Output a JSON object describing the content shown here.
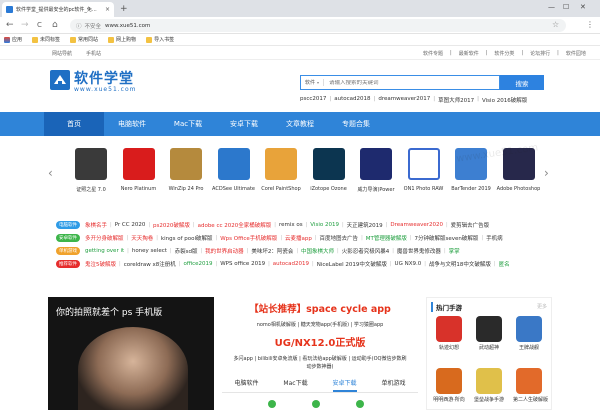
{
  "browser": {
    "tab_title": "软件学堂_提供最安全的pc软件_免...",
    "tab_close": "×",
    "new_tab": "+",
    "window_controls": [
      "—",
      "☐",
      "✕"
    ],
    "nav": {
      "back": "←",
      "forward": "→",
      "reload": "C",
      "home": "⌂"
    },
    "address": {
      "security": "不安全",
      "url": "www.xue51.com"
    },
    "bookmarks": [
      "应用",
      "未同标签",
      "常用同站",
      "网上购物",
      "导入书签"
    ]
  },
  "toplinks": {
    "left": [
      "网站导航",
      "手机站"
    ],
    "right": [
      "软件专题",
      "|",
      "最新软件",
      "|",
      "软件分类",
      "|",
      "论坛排行",
      "|",
      "软件园地"
    ]
  },
  "logo": {
    "cn": "软件学堂",
    "url": "www.xue51.com"
  },
  "search": {
    "category": "软件",
    "category_arrow": "▾",
    "placeholder": "请输入搜索的关键词",
    "button": "搜索",
    "hot": [
      "pscc2017",
      "|",
      "autocad2018",
      "|",
      "dreamweaver2017",
      "|",
      "草图大师2017",
      "|",
      "Visio 2016破解版"
    ]
  },
  "mainnav": [
    "首页",
    "电脑软件",
    "Mac下载",
    "安卓下载",
    "文章教程",
    "专题合集"
  ],
  "carousel": {
    "prev": "‹",
    "next": "›",
    "items": [
      {
        "label": "证照之星 7.0",
        "color": "#3a3a3a"
      },
      {
        "label": "Nero Platinum",
        "color": "#d91c1c"
      },
      {
        "label": "WinZip 24 Pro",
        "color": "#b58a3d"
      },
      {
        "label": "ACDSee Ultimate",
        "color": "#2c78cc"
      },
      {
        "label": "Corel PaintShop",
        "color": "#e8a33a"
      },
      {
        "label": "iZotope Ozone",
        "color": "#0c3550"
      },
      {
        "label": "威力导演(Power",
        "color": "#1e2a6e"
      },
      {
        "label": "ON1 Photo RAW",
        "color": "#ffffff"
      },
      {
        "label": "BarTender 2019",
        "color": "#3d7fd1"
      },
      {
        "label": "Adobe Photoshop",
        "color": "#27284b"
      }
    ]
  },
  "tagrows": [
    {
      "badge": "电脑软件",
      "badge_color": "#2f9be6",
      "items": [
        {
          "t": "象棋名手",
          "c": "#e62d2d"
        },
        {
          "t": "Pr CC 2020",
          "c": "#333333"
        },
        {
          "t": "ps2020破解版",
          "c": "#e62d2d"
        },
        {
          "t": "adobe cc 2020全家桶破解版",
          "c": "#e62d2d"
        },
        {
          "t": "remix os",
          "c": "#333333"
        },
        {
          "t": "Visio 2019",
          "c": "#1e9e3e"
        },
        {
          "t": "天正建筑2019",
          "c": "#333333"
        },
        {
          "t": "Dreamweaver2020",
          "c": "#e62d2d"
        },
        {
          "t": "爱剪辑去广告版",
          "c": "#333333"
        }
      ]
    },
    {
      "badge": "安卓软件",
      "badge_color": "#3db54a",
      "items": [
        {
          "t": "多开分身破解版",
          "c": "#e62d2d"
        },
        {
          "t": "天天掏卷",
          "c": "#e62d2d"
        },
        {
          "t": "kings of pool破解版",
          "c": "#333333"
        },
        {
          "t": "Wps Office手机破解版",
          "c": "#e62d2d"
        },
        {
          "t": "云麦播app",
          "c": "#e62d2d"
        },
        {
          "t": "百度地图去广告",
          "c": "#333333"
        },
        {
          "t": "MT管理器破解版",
          "c": "#1e9e3e"
        },
        {
          "t": "7分钟破解版seven破解版",
          "c": "#333333"
        },
        {
          "t": "手机病",
          "c": "#333333"
        }
      ]
    },
    {
      "badge": "单机游戏",
      "badge_color": "#f0a22c",
      "items": [
        {
          "t": "getting over it",
          "c": "#1e9e3e"
        },
        {
          "t": "honey select",
          "c": "#333333"
        },
        {
          "t": "赤裂sd版",
          "c": "#333333"
        },
        {
          "t": "我的世界启动器",
          "c": "#e62d2d"
        },
        {
          "t": "美味坏2：阿瓷会",
          "c": "#333333"
        },
        {
          "t": "中国象棋大师",
          "c": "#1e9e3e"
        },
        {
          "t": "火影忍者究极风暴4",
          "c": "#333333"
        },
        {
          "t": "魔兽世界鬼修改器",
          "c": "#333333"
        },
        {
          "t": "掌掌",
          "c": "#1e9e3e"
        }
      ]
    },
    {
      "badge": "推荐软件",
      "badge_color": "#e62d2d",
      "items": [
        {
          "t": "鬼泣5破解版",
          "c": "#e62d2d"
        },
        {
          "t": "coreldraw x8注册机",
          "c": "#333333"
        },
        {
          "t": "office2019",
          "c": "#1e9e3e"
        },
        {
          "t": "WPS office 2019",
          "c": "#333333"
        },
        {
          "t": "autocad2019",
          "c": "#e62d2d"
        },
        {
          "t": "NiceLabel 2019中文破解版",
          "c": "#333333"
        },
        {
          "t": "UG NX9.0",
          "c": "#333333"
        },
        {
          "t": "战争与文明18中文破解版",
          "c": "#333333"
        },
        {
          "t": "匿名",
          "c": "#1e9e3e"
        }
      ]
    }
  ],
  "banner": {
    "title": "你的拍照就差个 ps 手机版"
  },
  "promo": {
    "title": "【站长推荐】space cycle app",
    "sub1": "nomo相机破解版 | 糖天宠物app(手机版) | 学习猿圈app",
    "title2": "UG/NX12.0正式版",
    "sub2": "多闪app | bilibili安卓免流版 | 看玩法给app破解版 | 运动助手(OQ微信步数刷",
    "sub3": "动步数神器)",
    "tabs": [
      "电脑软件",
      "Mac下载",
      "安卓下载",
      "单机游戏"
    ]
  },
  "sidebar": {
    "title": "热门手游",
    "ghost": "更多",
    "games": [
      {
        "label": "轨迹幻想",
        "color": "#d8322a"
      },
      {
        "label": "武动超神",
        "color": "#2a2a2a"
      },
      {
        "label": "王牌战舰",
        "color": "#3a78c6"
      },
      {
        "label": "明明西游·所向",
        "color": "#d86a1e"
      },
      {
        "label": "堡垒战争手游",
        "color": "#e0c04a"
      },
      {
        "label": "第二人生破解版",
        "color": "#e26a2a"
      }
    ]
  },
  "watermark": "www.xue51.com"
}
